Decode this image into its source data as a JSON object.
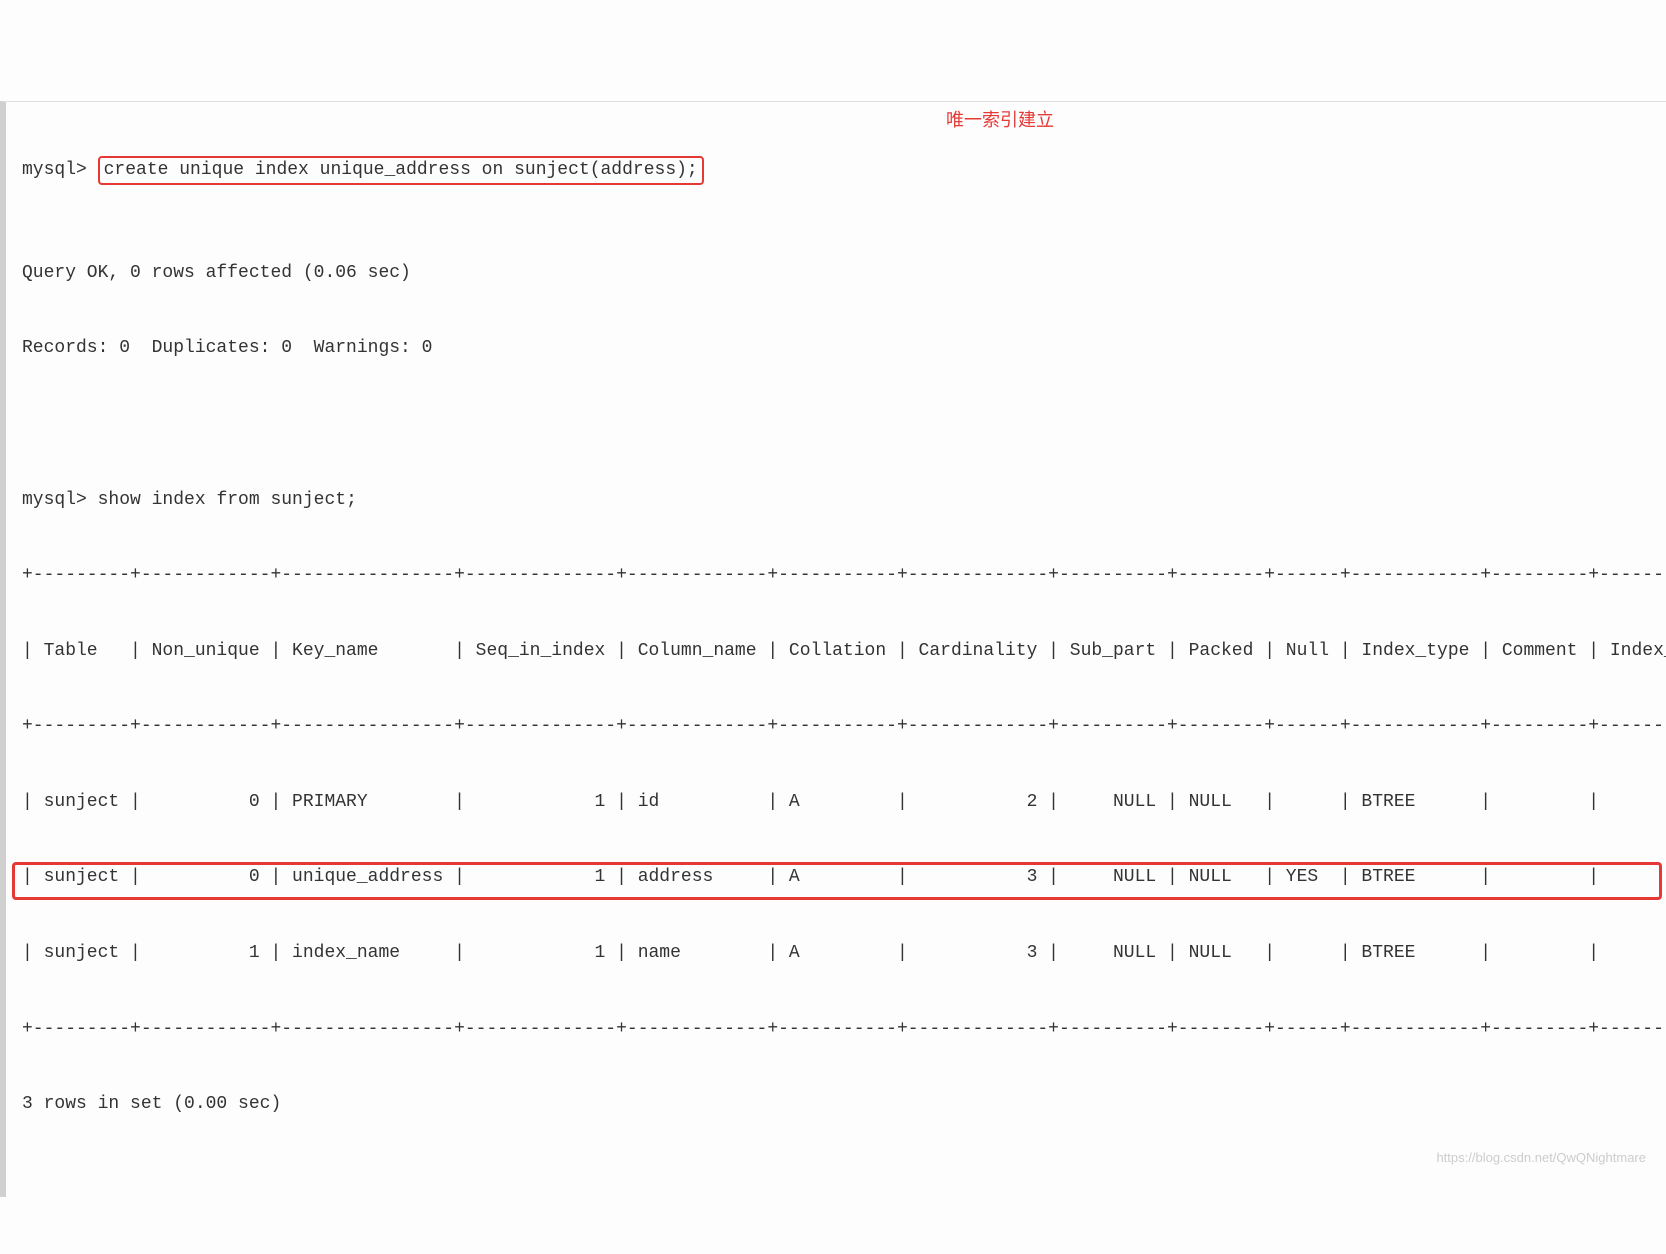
{
  "prompt": "mysql>",
  "cmd_create": "create unique index unique_address on sunject(address);",
  "annotation": "唯一索引建立",
  "result_line1": "Query OK, 0 rows affected (0.06 sec)",
  "result_line2": "Records: 0  Duplicates: 0  Warnings: 0",
  "cmd_show": "show index from sunject;",
  "sep_top": "+---------+------------+----------------+--------------+-------------+-----------+-------------+----------+--------+------+------------+---------+---------------+",
  "header": "| Table   | Non_unique | Key_name       | Seq_in_index | Column_name | Collation | Cardinality | Sub_part | Packed | Null | Index_type | Comment | Index_comment |",
  "row1": "| sunject |          0 | PRIMARY        |            1 | id          | A         |           2 |     NULL | NULL   |      | BTREE      |         |               |",
  "row2": "| sunject |          0 | unique_address |            1 | address     | A         |           3 |     NULL | NULL   | YES  | BTREE      |         |               |",
  "row3": "| sunject |          1 | index_name     |            1 | name        | A         |           3 |     NULL | NULL   |      | BTREE      |         |               |",
  "footer": "3 rows in set (0.00 sec)",
  "watermark": "https://blog.csdn.net/QwQNightmare"
}
